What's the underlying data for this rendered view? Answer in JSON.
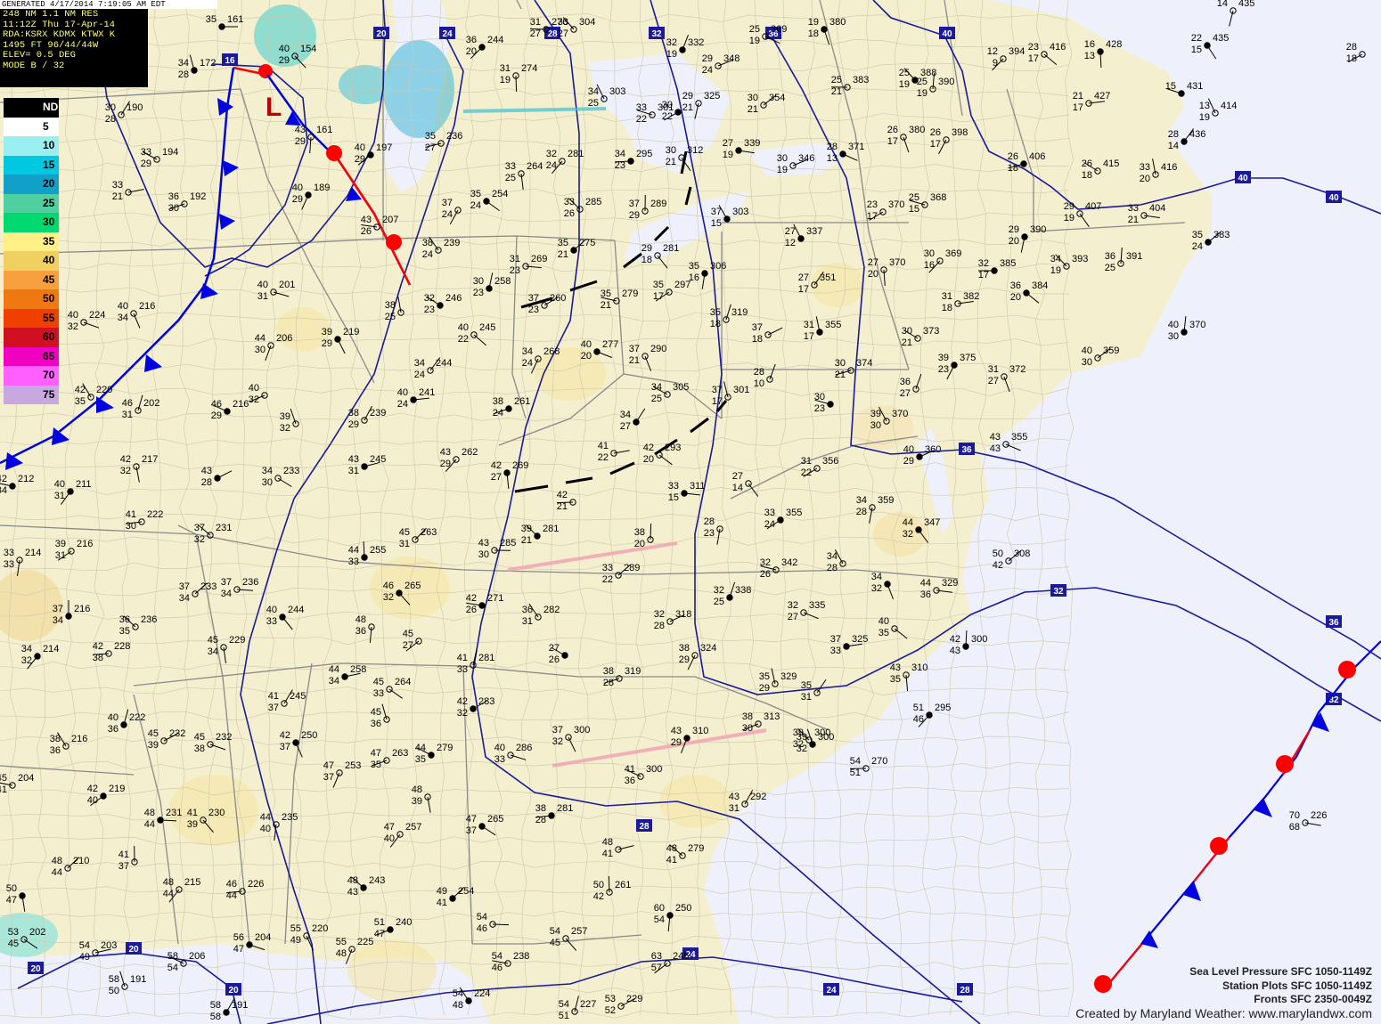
{
  "header": {
    "generated": "GENERATED 4/17/2014 7:19:05 AM EDT",
    "lines": [
      "248 NM 1.1 NM RES",
      "11:12Z Thu 17-Apr-14",
      "RDA:KSRX KDMX KTWX K",
      "1495 FT   96/44/44W",
      "ELEV= 0.5 DEG",
      "MODE B / 32"
    ]
  },
  "legend": {
    "items": [
      {
        "label": "ND",
        "color": "#000000"
      },
      {
        "label": "5",
        "color": "#ffffff"
      },
      {
        "label": "10",
        "color": "#9af0f0"
      },
      {
        "label": "15",
        "color": "#00c8e0"
      },
      {
        "label": "20",
        "color": "#10a0c8"
      },
      {
        "label": "25",
        "color": "#50d0a0"
      },
      {
        "label": "30",
        "color": "#00d870"
      },
      {
        "label": "35",
        "color": "#fff088"
      },
      {
        "label": "40",
        "color": "#f0d060"
      },
      {
        "label": "45",
        "color": "#f8a040"
      },
      {
        "label": "50",
        "color": "#f07810"
      },
      {
        "label": "55",
        "color": "#f04000"
      },
      {
        "label": "60",
        "color": "#d01020"
      },
      {
        "label": "65",
        "color": "#f000c0"
      },
      {
        "label": "70",
        "color": "#ff60ff"
      },
      {
        "label": "75",
        "color": "#c8a8e0"
      }
    ]
  },
  "colors": {
    "cold_front": "#0000e0",
    "warm_front": "#ff0000",
    "isobar": "#1a1a9a",
    "land": "#f3efcf",
    "ocean": "#eef0fb",
    "county": "#c9c3a6",
    "state": "#8f8f8f"
  },
  "symbols": {
    "low_pressure": "L"
  },
  "isobars": [
    {
      "label": "16"
    },
    {
      "label": "20"
    },
    {
      "label": "24"
    },
    {
      "label": "28"
    },
    {
      "label": "32"
    },
    {
      "label": "36"
    },
    {
      "label": "40"
    }
  ],
  "stations": [
    {
      "t": "35",
      "d": "",
      "p": "161"
    },
    {
      "t": "40",
      "d": "29",
      "p": "154"
    },
    {
      "t": "43",
      "d": "29",
      "p": "161"
    },
    {
      "t": "40",
      "d": "29",
      "p": "197"
    },
    {
      "t": "43",
      "d": "26",
      "p": "207"
    },
    {
      "t": "38",
      "d": "24",
      "p": "239"
    },
    {
      "t": "30",
      "d": "23",
      "p": "258"
    },
    {
      "t": "37",
      "d": "23",
      "p": "260"
    },
    {
      "t": "40",
      "d": "31",
      "p": "201"
    },
    {
      "t": "39",
      "d": "29",
      "p": "219"
    },
    {
      "t": "44",
      "d": "30",
      "p": "206"
    },
    {
      "t": "40",
      "d": "32",
      "p": ""
    },
    {
      "t": "46",
      "d": "29",
      "p": "216"
    },
    {
      "t": "39",
      "d": "32",
      "p": ""
    },
    {
      "t": "38",
      "d": "29",
      "p": "239"
    },
    {
      "t": "43",
      "d": "31",
      "p": "245"
    },
    {
      "t": "34",
      "d": "30",
      "p": "233"
    },
    {
      "t": "42",
      "d": "32",
      "p": "217"
    },
    {
      "t": "40",
      "d": "31",
      "p": "211"
    },
    {
      "t": "41",
      "d": "30",
      "p": "222"
    },
    {
      "t": "37",
      "d": "32",
      "p": "231"
    },
    {
      "t": "44",
      "d": "33",
      "p": "255"
    },
    {
      "t": "45",
      "d": "31",
      "p": "263"
    },
    {
      "t": "43",
      "d": "30",
      "p": "285"
    },
    {
      "t": "46",
      "d": "32",
      "p": "265"
    },
    {
      "t": "48",
      "d": "36",
      "p": ""
    },
    {
      "t": "45",
      "d": "27",
      "p": ""
    },
    {
      "t": "42",
      "d": "26",
      "p": "271"
    },
    {
      "t": "36",
      "d": "31",
      "p": "282"
    },
    {
      "t": "41",
      "d": "33",
      "p": "281"
    },
    {
      "t": "42",
      "d": "32",
      "p": "283"
    },
    {
      "t": "40",
      "d": "33",
      "p": "286"
    },
    {
      "t": "37",
      "d": "32",
      "p": "300"
    },
    {
      "t": "43",
      "d": "29",
      "p": "310"
    },
    {
      "t": "38",
      "d": "30",
      "p": "313"
    },
    {
      "t": "41",
      "d": "36",
      "p": "300"
    },
    {
      "t": "39",
      "d": "32",
      "p": "300"
    },
    {
      "t": "43",
      "d": "31",
      "p": "292"
    },
    {
      "t": "48",
      "d": "41",
      "p": ""
    },
    {
      "t": "47",
      "d": "37",
      "p": "265"
    },
    {
      "t": "48",
      "d": "39",
      "p": ""
    },
    {
      "t": "47",
      "d": "40",
      "p": "257"
    },
    {
      "t": "38",
      "d": "28",
      "p": "281"
    },
    {
      "t": "48",
      "d": "41",
      "p": "279"
    },
    {
      "t": "50",
      "d": "42",
      "p": "261"
    },
    {
      "t": "49",
      "d": "41",
      "p": "254"
    },
    {
      "t": "54",
      "d": "46",
      "p": ""
    },
    {
      "t": "54",
      "d": "45",
      "p": "257"
    },
    {
      "t": "60",
      "d": "54",
      "p": "250"
    },
    {
      "t": "63",
      "d": "57",
      "p": "245"
    },
    {
      "t": "54",
      "d": "46",
      "p": "238"
    },
    {
      "t": "54",
      "d": "48",
      "p": "224"
    },
    {
      "t": "54",
      "d": "51",
      "p": "227"
    },
    {
      "t": "53",
      "d": "52",
      "p": "229"
    },
    {
      "t": "56",
      "d": "47",
      "p": "204"
    },
    {
      "t": "55",
      "d": "49",
      "p": "220"
    },
    {
      "t": "55",
      "d": "48",
      "p": "225"
    },
    {
      "t": "51",
      "d": "47",
      "p": "240"
    },
    {
      "t": "58",
      "d": "54",
      "p": "206"
    },
    {
      "t": "58",
      "d": "50",
      "p": "191"
    },
    {
      "t": "58",
      "d": "58",
      "p": "191"
    },
    {
      "t": "54",
      "d": "49",
      "p": "203"
    },
    {
      "t": "53",
      "d": "45",
      "p": "202"
    },
    {
      "t": "50",
      "d": "47",
      "p": ""
    },
    {
      "t": "48",
      "d": "44",
      "p": "215"
    },
    {
      "t": "46",
      "d": "44",
      "p": "226"
    },
    {
      "t": "48",
      "d": "43",
      "p": "243"
    },
    {
      "t": "41",
      "d": "37",
      "p": ""
    },
    {
      "t": "48",
      "d": "44",
      "p": "210"
    },
    {
      "t": "48",
      "d": "44",
      "p": "231"
    },
    {
      "t": "41",
      "d": "39",
      "p": "230"
    },
    {
      "t": "44",
      "d": "40",
      "p": "235"
    },
    {
      "t": "42",
      "d": "40",
      "p": "219"
    },
    {
      "t": "45",
      "d": "41",
      "p": "204"
    },
    {
      "t": "38",
      "d": "36",
      "p": "216"
    },
    {
      "t": "40",
      "d": "36",
      "p": "222"
    },
    {
      "t": "45",
      "d": "39",
      "p": "232"
    },
    {
      "t": "45",
      "d": "38",
      "p": "232"
    },
    {
      "t": "42",
      "d": "37",
      "p": "250"
    },
    {
      "t": "47",
      "d": "37",
      "p": "253"
    },
    {
      "t": "47",
      "d": "35",
      "p": "263"
    },
    {
      "t": "44",
      "d": "35",
      "p": "279"
    },
    {
      "t": "45",
      "d": "36",
      "p": ""
    },
    {
      "t": "41",
      "d": "37",
      "p": "245"
    },
    {
      "t": "44",
      "d": "34",
      "p": "258"
    },
    {
      "t": "45",
      "d": "33",
      "p": "264"
    },
    {
      "t": "45",
      "d": "34",
      "p": "229"
    },
    {
      "t": "34",
      "d": "32",
      "p": "214"
    },
    {
      "t": "42",
      "d": "38",
      "p": "228"
    },
    {
      "t": "36",
      "d": "35",
      "p": "236"
    },
    {
      "t": "37",
      "d": "34",
      "p": "216"
    },
    {
      "t": "37",
      "d": "34",
      "p": "233"
    },
    {
      "t": "37",
      "d": "34",
      "p": "236"
    },
    {
      "t": "40",
      "d": "33",
      "p": "244"
    },
    {
      "t": "33",
      "d": "33",
      "p": "214"
    },
    {
      "t": "39",
      "d": "31",
      "p": "216"
    },
    {
      "t": "42",
      "d": "34",
      "p": "212"
    },
    {
      "t": "42",
      "d": "35",
      "p": "220"
    },
    {
      "t": "46",
      "d": "31",
      "p": "202"
    },
    {
      "t": "43",
      "d": "28",
      "p": ""
    },
    {
      "t": "40",
      "d": "32",
      "p": "224"
    },
    {
      "t": "40",
      "d": "34",
      "p": "216"
    },
    {
      "t": "40",
      "d": "29",
      "p": "189"
    },
    {
      "t": "36",
      "d": "30",
      "p": "192"
    },
    {
      "t": "33",
      "d": "29",
      "p": "194"
    },
    {
      "t": "34",
      "d": "28",
      "p": "172"
    },
    {
      "t": "30",
      "d": "28",
      "p": "190"
    },
    {
      "t": "33",
      "d": "21",
      "p": ""
    },
    {
      "t": "35",
      "d": "24",
      "p": "254"
    },
    {
      "t": "33",
      "d": "25",
      "p": "264"
    },
    {
      "t": "32",
      "d": "24",
      "p": "281"
    },
    {
      "t": "34",
      "d": "23",
      "p": "295"
    },
    {
      "t": "33",
      "d": "26",
      "p": "285"
    },
    {
      "t": "37",
      "d": "29",
      "p": "289"
    },
    {
      "t": "35",
      "d": "21",
      "p": "275"
    },
    {
      "t": "31",
      "d": "23",
      "p": "269"
    },
    {
      "t": "29",
      "d": "18",
      "p": "281"
    },
    {
      "t": "35",
      "d": "16",
      "p": "306"
    },
    {
      "t": "35",
      "d": "17",
      "p": "297"
    },
    {
      "t": "35",
      "d": "21",
      "p": "279"
    },
    {
      "t": "37",
      "d": "15",
      "p": "303"
    },
    {
      "t": "35",
      "d": "18",
      "p": "319"
    },
    {
      "t": "37",
      "d": "18",
      "p": ""
    },
    {
      "t": "40",
      "d": "20",
      "p": "277"
    },
    {
      "t": "37",
      "d": "21",
      "p": "290"
    },
    {
      "t": "34",
      "d": "24",
      "p": "268"
    },
    {
      "t": "38",
      "d": "24",
      "p": "261"
    },
    {
      "t": "34",
      "d": "25",
      "p": "305"
    },
    {
      "t": "37",
      "d": "17",
      "p": "301"
    },
    {
      "t": "34",
      "d": "27",
      "p": ""
    },
    {
      "t": "41",
      "d": "22",
      "p": ""
    },
    {
      "t": "42",
      "d": "20",
      "p": "293"
    },
    {
      "t": "42",
      "d": "27",
      "p": "269"
    },
    {
      "t": "43",
      "d": "29",
      "p": "262"
    },
    {
      "t": "42",
      "d": "21",
      "p": ""
    },
    {
      "t": "39",
      "d": "21",
      "p": "281"
    },
    {
      "t": "38",
      "d": "20",
      "p": ""
    },
    {
      "t": "33",
      "d": "22",
      "p": "289"
    },
    {
      "t": "33",
      "d": "15",
      "p": "311"
    },
    {
      "t": "27",
      "d": "14",
      "p": ""
    },
    {
      "t": "28",
      "d": "23",
      "p": ""
    },
    {
      "t": "33",
      "d": "24",
      "p": "355"
    },
    {
      "t": "32",
      "d": "26",
      "p": "342"
    },
    {
      "t": "34",
      "d": "28",
      "p": ""
    },
    {
      "t": "32",
      "d": "25",
      "p": "338"
    },
    {
      "t": "32",
      "d": "28",
      "p": "318"
    },
    {
      "t": "32",
      "d": "27",
      "p": "335"
    },
    {
      "t": "34",
      "d": "32",
      "p": ""
    },
    {
      "t": "38",
      "d": "29",
      "p": "324"
    },
    {
      "t": "38",
      "d": "28",
      "p": "319"
    },
    {
      "t": "27",
      "d": "26",
      "p": ""
    },
    {
      "t": "35",
      "d": "29",
      "p": "329"
    },
    {
      "t": "35",
      "d": "31",
      "p": ""
    },
    {
      "t": "37",
      "d": "33",
      "p": "325"
    },
    {
      "t": "40",
      "d": "35",
      "p": ""
    },
    {
      "t": "43",
      "d": "35",
      "p": "310"
    },
    {
      "t": "51",
      "d": "46",
      "p": "295"
    },
    {
      "t": "54",
      "d": "51",
      "p": "270"
    },
    {
      "t": "39",
      "d": "32",
      "p": "300"
    },
    {
      "t": "42",
      "d": "43",
      "p": "300"
    },
    {
      "t": "50",
      "d": "42",
      "p": "308"
    },
    {
      "t": "44",
      "d": "36",
      "p": "329"
    },
    {
      "t": "44",
      "d": "32",
      "p": "347"
    },
    {
      "t": "34",
      "d": "28",
      "p": "359"
    },
    {
      "t": "31",
      "d": "22",
      "p": "356"
    },
    {
      "t": "30",
      "d": "23",
      "p": ""
    },
    {
      "t": "39",
      "d": "30",
      "p": "370"
    },
    {
      "t": "36",
      "d": "27",
      "p": ""
    },
    {
      "t": "40",
      "d": "29",
      "p": "360"
    },
    {
      "t": "43",
      "d": "43",
      "p": "355"
    },
    {
      "t": "31",
      "d": "27",
      "p": "372"
    },
    {
      "t": "39",
      "d": "23",
      "p": "375"
    },
    {
      "t": "30",
      "d": "21",
      "p": "374"
    },
    {
      "t": "30",
      "d": "21",
      "p": "373"
    },
    {
      "t": "31",
      "d": "17",
      "p": "355"
    },
    {
      "t": "27",
      "d": "17",
      "p": "351"
    },
    {
      "t": "31",
      "d": "18",
      "p": "382"
    },
    {
      "t": "36",
      "d": "20",
      "p": "384"
    },
    {
      "t": "27",
      "d": "20",
      "p": "370"
    },
    {
      "t": "30",
      "d": "16",
      "p": "369"
    },
    {
      "t": "32",
      "d": "17",
      "p": "385"
    },
    {
      "t": "34",
      "d": "19",
      "p": "393"
    },
    {
      "t": "36",
      "d": "25",
      "p": "391"
    },
    {
      "t": "35",
      "d": "24",
      "p": "383"
    },
    {
      "t": "33",
      "d": "21",
      "p": "404"
    },
    {
      "t": "29",
      "d": "19",
      "p": "407"
    },
    {
      "t": "29",
      "d": "20",
      "p": "390"
    },
    {
      "t": "23",
      "d": "17",
      "p": "370"
    },
    {
      "t": "25",
      "d": "15",
      "p": "368"
    },
    {
      "t": "27",
      "d": "12",
      "p": "337"
    },
    {
      "t": "28",
      "d": "10",
      "p": ""
    },
    {
      "t": "30",
      "d": "19",
      "p": "346"
    },
    {
      "t": "28",
      "d": "13",
      "p": "371"
    },
    {
      "t": "26",
      "d": "17",
      "p": "380"
    },
    {
      "t": "26",
      "d": "17",
      "p": "398"
    },
    {
      "t": "26",
      "d": "18",
      "p": "406"
    },
    {
      "t": "26",
      "d": "18",
      "p": "415"
    },
    {
      "t": "33",
      "d": "20",
      "p": "416"
    },
    {
      "t": "28",
      "d": "14",
      "p": "436"
    },
    {
      "t": "21",
      "d": "17",
      "p": "427"
    },
    {
      "t": "23",
      "d": "17",
      "p": "416"
    },
    {
      "t": "16",
      "d": "13",
      "p": "428"
    },
    {
      "t": "12",
      "d": "9",
      "p": "394"
    },
    {
      "t": "25",
      "d": "21",
      "p": "383"
    },
    {
      "t": "25",
      "d": "19",
      "p": "388"
    },
    {
      "t": "25",
      "d": "19",
      "p": "390"
    },
    {
      "t": "30",
      "d": "21",
      "p": "354"
    },
    {
      "t": "27",
      "d": "19",
      "p": "339"
    },
    {
      "t": "30",
      "d": "21",
      "p": "312"
    },
    {
      "t": "29",
      "d": "21",
      "p": "325"
    },
    {
      "t": "30",
      "d": "22",
      "p": ""
    },
    {
      "t": "33",
      "d": "22",
      "p": "301"
    },
    {
      "t": "34",
      "d": "25",
      "p": "303"
    },
    {
      "t": "32",
      "d": "19",
      "p": "332"
    },
    {
      "t": "29",
      "d": "24",
      "p": "348"
    },
    {
      "t": "25",
      "d": "19",
      "p": "369"
    },
    {
      "t": "19",
      "d": "18",
      "p": "380"
    },
    {
      "t": "37",
      "d": "24",
      "p": ""
    },
    {
      "t": "35",
      "d": "27",
      "p": "236"
    },
    {
      "t": "32",
      "d": "23",
      "p": "246"
    },
    {
      "t": "38",
      "d": "25",
      "p": ""
    },
    {
      "t": "34",
      "d": "24",
      "p": "244"
    },
    {
      "t": "40",
      "d": "24",
      "p": "241"
    },
    {
      "t": "40",
      "d": "22",
      "p": "245"
    },
    {
      "t": "31",
      "d": "19",
      "p": "274"
    },
    {
      "t": "36",
      "d": "20",
      "p": "244"
    },
    {
      "t": "31",
      "d": "27",
      "p": "276"
    },
    {
      "t": "33",
      "d": "27",
      "p": "304"
    },
    {
      "t": "40",
      "d": "30",
      "p": "370"
    },
    {
      "t": "40",
      "d": "30",
      "p": "359"
    },
    {
      "t": "70",
      "d": "68",
      "p": "226"
    },
    {
      "t": "22",
      "d": "15",
      "p": "435"
    },
    {
      "t": "14",
      "d": "",
      "p": "435"
    },
    {
      "t": "28",
      "d": "18",
      "p": ""
    },
    {
      "t": "15",
      "d": "",
      "p": "431"
    },
    {
      "t": "13",
      "d": "19",
      "p": "414"
    }
  ],
  "credit": {
    "line1": "Sea Level Pressure SFC 1050-1149Z",
    "line2": "Station Plots SFC 1050-1149Z",
    "line3": "Fronts SFC 2350-0049Z",
    "line4": "Created by Maryland Weather: www.marylandwx.com"
  }
}
